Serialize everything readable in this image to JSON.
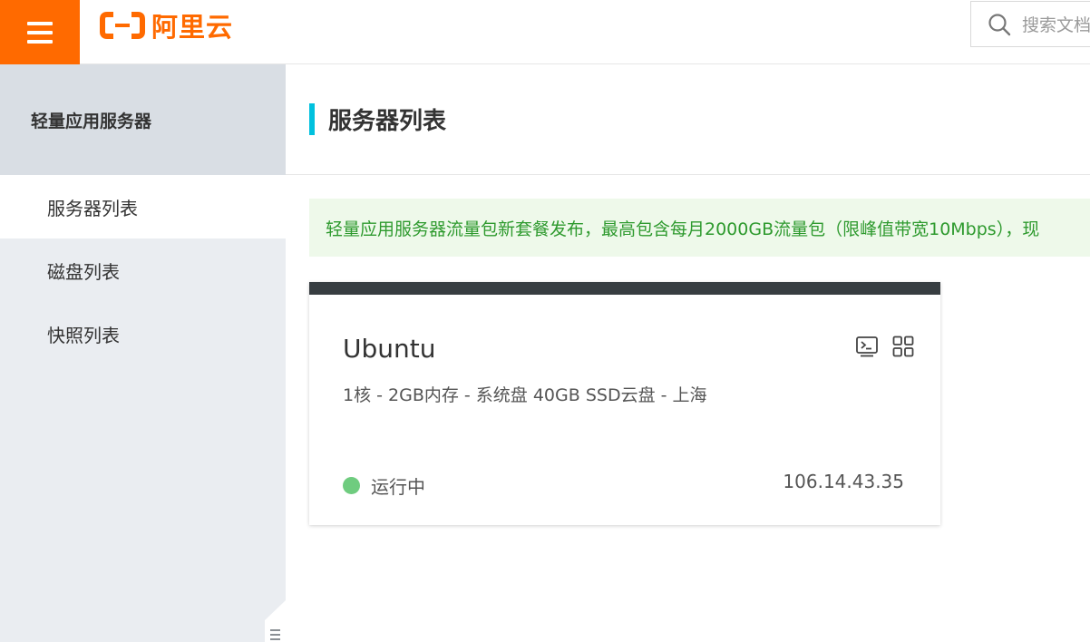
{
  "header": {
    "logo_text": "阿里云",
    "search_placeholder": "搜索文档",
    "brand_color": "#ff6a00"
  },
  "sidebar": {
    "title": "轻量应用服务器",
    "items": [
      {
        "label": "服务器列表",
        "active": true
      },
      {
        "label": "磁盘列表",
        "active": false
      },
      {
        "label": "快照列表",
        "active": false
      }
    ]
  },
  "main": {
    "page_title": "服务器列表",
    "notice": "轻量应用服务器流量包新套餐发布，最高包含每月2000GB流量包（限峰值带宽10Mbps），现",
    "servers": [
      {
        "name": "Ubuntu",
        "spec": "1核 - 2GB内存 - 系统盘 40GB SSD云盘 - 上海",
        "status": "运行中",
        "status_color": "#6fcc7f",
        "ip": "106.14.43.35"
      }
    ]
  },
  "icons": [
    "menu-icon",
    "aliyun-logo-icon",
    "search-icon",
    "terminal-icon",
    "grid-icon",
    "collapse-icon"
  ]
}
